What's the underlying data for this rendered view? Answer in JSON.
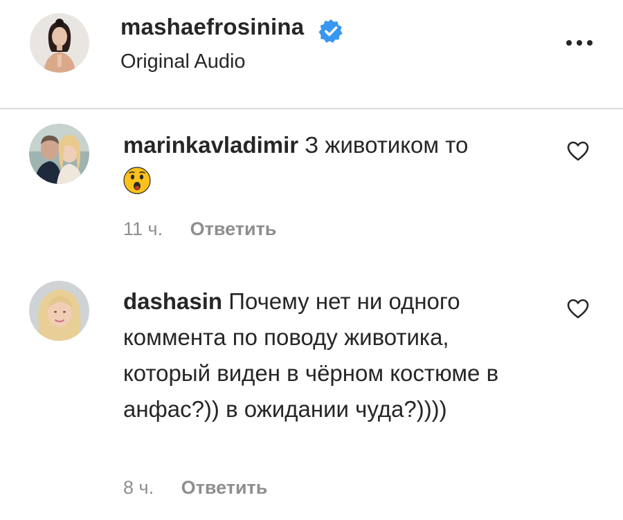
{
  "post_header": {
    "username": "mashaefrosinina",
    "verified": true,
    "subtitle": "Original Audio",
    "more_icon": "more-options-icon"
  },
  "comments": [
    {
      "username": "marinkavladimir",
      "text": "З животиком то",
      "emoji": "astonished-face",
      "time": "11 ч.",
      "reply_label": "Ответить"
    },
    {
      "username": "dashasin",
      "text": "Почему нет ни одного комментa по поводу животика, который виден в чёрном костюме в анфас?)) в ожидании чуда?))))",
      "time": "8 ч.",
      "reply_label": "Ответить"
    }
  ],
  "colors": {
    "text": "#262626",
    "secondary": "#8e8e8e",
    "verified_blue": "#3897f0",
    "divider": "#dbdbdb"
  }
}
